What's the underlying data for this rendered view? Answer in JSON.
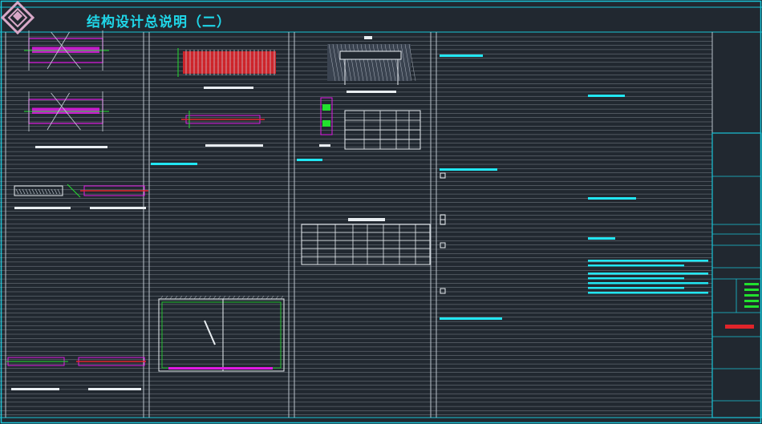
{
  "page": {
    "title": "结构设计总说明（二）"
  },
  "colors": {
    "background": "#212830",
    "frame": "#19c3d6",
    "rule": "#c9d1da",
    "cyan_text": "#22e6f2",
    "white_text": "#e9eef2",
    "magenta": "#e01ae4",
    "green": "#22e02e",
    "red": "#e0242a",
    "seal": "#d8a8c8"
  },
  "icons": {
    "seal": "diamond-seal-icon"
  }
}
